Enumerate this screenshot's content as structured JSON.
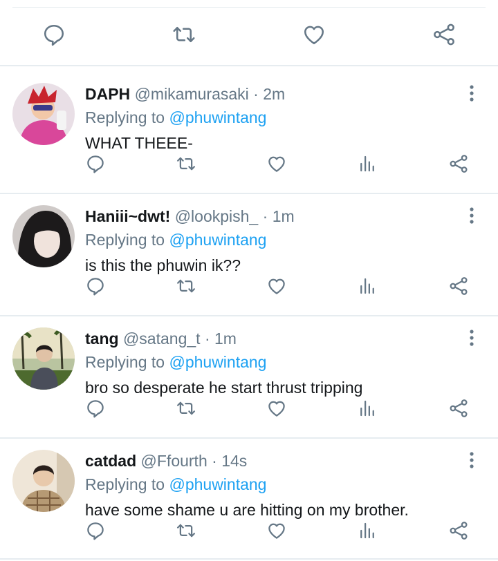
{
  "colors": {
    "text": "#14171a",
    "secondary": "#657786",
    "link": "#1da1f2",
    "divider": "#e6ecf0"
  },
  "icons": {
    "reply": "comment-icon",
    "retweet": "retweet-icon",
    "like": "heart-icon",
    "stats": "analytics-icon",
    "share": "share-icon",
    "more": "more-vertical-icon"
  },
  "replies": [
    {
      "name": "DAPH",
      "handle": "@mikamurasaki",
      "sep": "·",
      "time": "2m",
      "replying_prefix": "Replying to",
      "mention": "@phuwintang",
      "text": "WHAT THEEE-"
    },
    {
      "name": "Haniii~dwt!",
      "handle": "@lookpish_",
      "sep": "·",
      "time": "1m",
      "replying_prefix": "Replying to",
      "mention": "@phuwintang",
      "text": "is this the phuwin ik??"
    },
    {
      "name": "tang",
      "handle": "@satang_t",
      "sep": "·",
      "time": "1m",
      "replying_prefix": "Replying to",
      "mention": "@phuwintang",
      "text": "bro so desperate he start thrust tripping"
    },
    {
      "name": "catdad",
      "handle": "@Ffourth",
      "sep": "·",
      "time": "14s",
      "replying_prefix": "Replying to",
      "mention": "@phuwintang",
      "text": "have some shame u are hitting on my brother."
    }
  ]
}
